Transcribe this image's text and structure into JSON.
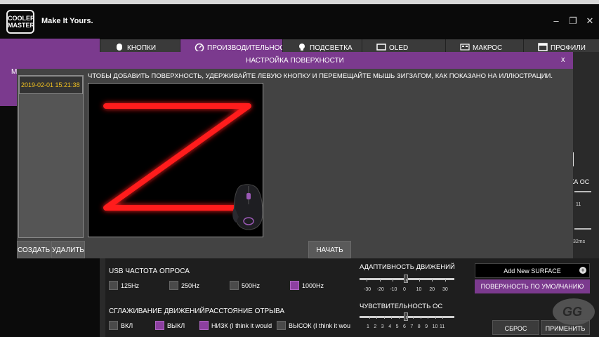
{
  "app": {
    "logo_text_1": "COOLER",
    "logo_text_2": "MASTER",
    "slogan": "Make It Yours.",
    "window_controls": {
      "minimize": "–",
      "maximize": "❐",
      "close": "✕"
    }
  },
  "tabs": [
    {
      "label": "КНОПКИ",
      "icon": "mouse-icon",
      "active": false
    },
    {
      "label": "ПРОИЗВОДИТЕЛЬНОСТЬ",
      "icon": "speedometer-icon",
      "active": true
    },
    {
      "label": "ПОДСВЕТКА",
      "icon": "bulb-icon",
      "active": false
    },
    {
      "label": "OLED",
      "icon": "oled-icon",
      "active": false
    },
    {
      "label": "МАКРОС",
      "icon": "macro-icon",
      "active": false
    },
    {
      "label": "ПРОФИЛИ",
      "icon": "profile-icon",
      "active": false
    }
  ],
  "left_tab": {
    "label": "М"
  },
  "background_right": {
    "label": "КА ОС",
    "scale_end": "11",
    "ms_value": "32ms"
  },
  "usb": {
    "title_prefix": "USB",
    "title_rest": " ЧАСТОТА ОПРОСА",
    "options": [
      {
        "label": "125Hz",
        "checked": false
      },
      {
        "label": "250Hz",
        "checked": false
      },
      {
        "label": "500Hz",
        "checked": false
      },
      {
        "label": "1000Hz",
        "checked": true
      }
    ]
  },
  "smoothing": {
    "title": "СГЛАЖИВАНИЕ ДВИЖЕНИЙ",
    "liftoff_title": "РАССТОЯНИЕ ОТРЫВА",
    "options": [
      {
        "label": "ВКЛ",
        "checked": false
      },
      {
        "label": "ВЫКЛ",
        "checked": true
      }
    ],
    "liftoff_options": [
      {
        "label": "НИЗК (I think it would",
        "checked": true
      },
      {
        "label": "ВЫСОК (I think it wou",
        "checked": false
      }
    ]
  },
  "adaptive": {
    "title": "АДАПТИВНОСТЬ ДВИЖЕНИЙ",
    "ticks": [
      "-30",
      "-20",
      "-10",
      "0",
      "10",
      "20",
      "30"
    ],
    "value": 0
  },
  "sensitivity": {
    "title": "ЧУВСТВИТЕЛЬНОСТЬ ОС",
    "ticks": [
      "1",
      "2",
      "3",
      "4",
      "5",
      "6",
      "7",
      "8",
      "9",
      "10",
      "11"
    ],
    "value": 6
  },
  "surface": {
    "add_label": "Add New SURFACE",
    "add_icon": "+",
    "default_label": "ПОВЕРХНОСТЬ ПО УМОЛЧАНИЮ"
  },
  "footer": {
    "reset": "СБРОС",
    "apply": "ПРИМЕНИТЬ"
  },
  "modal": {
    "title": "НАСТРОЙКА ПОВЕРХНОСТИ",
    "close": "x",
    "instruction": "ЧТОБЫ ДОБАВИТЬ ПОВЕРХНОСТЬ, УДЕРЖИВАЙТЕ ЛЕВУЮ КНОПКУ И ПЕРЕМЕЩАЙТЕ МЫШЬ ЗИГЗАГОМ, КАК ПОКАЗАНО НА ИЛЛЮСТРАЦИИ.",
    "list_items": [
      "2019-02-01 15:21:38"
    ],
    "create": "СОЗДАТЬ",
    "delete": "УДАЛИТЬ",
    "start": "НАЧАТЬ"
  },
  "watermark": {
    "text": "GG"
  },
  "colors": {
    "accent": "#7b3a8e",
    "zigzag": "#ff1a1a",
    "list_date": "#f0c020"
  }
}
